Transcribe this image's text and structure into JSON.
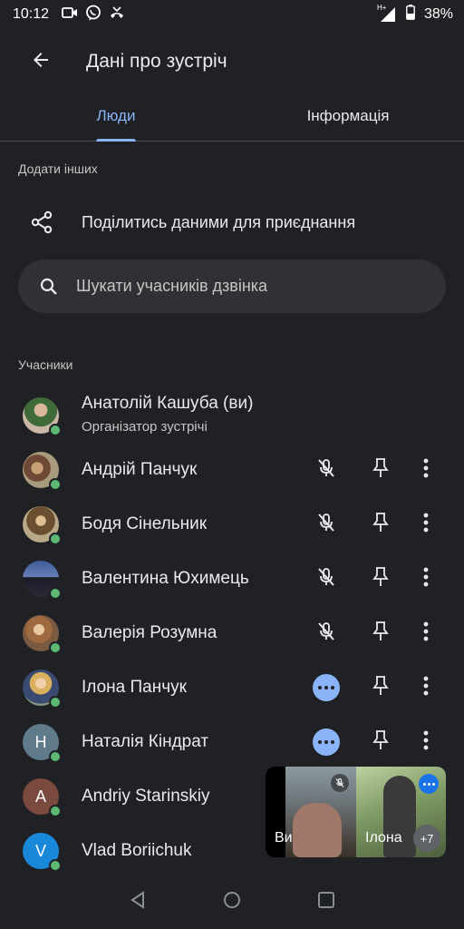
{
  "status_bar": {
    "time": "10:12",
    "battery": "38%",
    "network": "H+",
    "icons": [
      "video-call-icon",
      "viber-icon",
      "missed-call-icon"
    ]
  },
  "app_bar": {
    "title": "Дані про зустріч"
  },
  "tabs": [
    {
      "label": "Люди",
      "active": true
    },
    {
      "label": "Інформація",
      "active": false
    }
  ],
  "add_others": {
    "label": "Додати інших",
    "share_label": "Поділитись даними для приєднання"
  },
  "search": {
    "placeholder": "Шукати учасників дзвінка"
  },
  "participants_label": "Учасники",
  "participants": [
    {
      "name": "Анатолій Кашуба (ви)",
      "subtitle": "Організатор зустрічі",
      "avatar": "photo",
      "online": true
    },
    {
      "name": "Андрій Панчук",
      "avatar": "photo",
      "mic": "muted",
      "online": true
    },
    {
      "name": "Бодя Сінельник",
      "avatar": "photo",
      "mic": "muted",
      "online": true
    },
    {
      "name": "Валентина Юхимець",
      "avatar": "photo",
      "mic": "muted",
      "online": true
    },
    {
      "name": "Валерія Розумна",
      "avatar": "photo",
      "mic": "muted",
      "online": true
    },
    {
      "name": "Ілона Панчук",
      "avatar": "photo",
      "mic": "speaking",
      "online": true
    },
    {
      "name": "Наталія Кіндрат",
      "avatar_letter": "Н",
      "avatar_color": "#5f7a8a",
      "mic": "speaking",
      "online": true
    },
    {
      "name": "Andriy Starinskiy",
      "avatar_letter": "A",
      "avatar_color": "#7a4a3e",
      "online": true
    },
    {
      "name": "Vlad Boriichuk",
      "avatar_letter": "V",
      "avatar_color": "#1a88d8",
      "online": true
    }
  ],
  "pip": {
    "left_label": "Ви",
    "right_label": "Ілона",
    "more_count": "+7"
  },
  "colors": {
    "background": "#202124",
    "accent": "#8ab4f8",
    "online": "#5bb974"
  }
}
